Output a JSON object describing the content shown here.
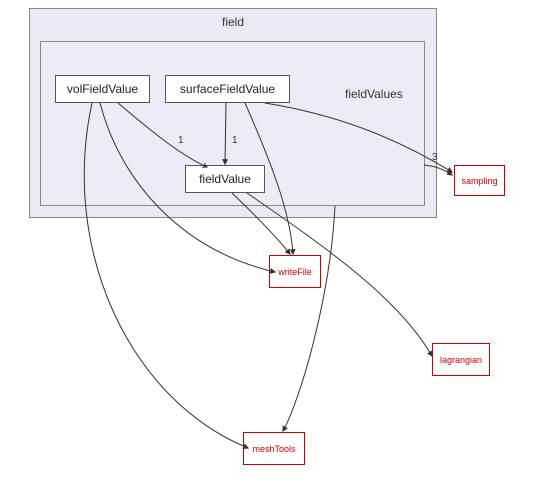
{
  "clusters": {
    "outer": {
      "label": "field"
    },
    "inner_text": "fieldValues"
  },
  "nodes": {
    "volFieldValue": "volFieldValue",
    "surfaceFieldValue": "surfaceFieldValue",
    "fieldValue": "fieldValue",
    "sampling": "sampling",
    "writeFile": "writeFile",
    "lagrangian": "lagrangian",
    "meshTools": "meshTools"
  },
  "edge_labels": {
    "vfv_fv": "1",
    "sfv_fv": "1",
    "fieldValues_sampling": "3"
  },
  "chart_data": {
    "type": "diagram",
    "title": "field / fieldValues dependency graph",
    "clusters": [
      {
        "id": "field",
        "contains": [
          "fieldValues"
        ]
      },
      {
        "id": "fieldValues",
        "contains": [
          "volFieldValue",
          "surfaceFieldValue",
          "fieldValue"
        ]
      }
    ],
    "nodes": [
      {
        "id": "volFieldValue",
        "kind": "dir"
      },
      {
        "id": "surfaceFieldValue",
        "kind": "dir"
      },
      {
        "id": "fieldValue",
        "kind": "dir"
      },
      {
        "id": "sampling",
        "kind": "external"
      },
      {
        "id": "writeFile",
        "kind": "external"
      },
      {
        "id": "lagrangian",
        "kind": "external"
      },
      {
        "id": "meshTools",
        "kind": "external"
      }
    ],
    "edges": [
      {
        "from": "volFieldValue",
        "to": "fieldValue",
        "count": 1
      },
      {
        "from": "surfaceFieldValue",
        "to": "fieldValue",
        "count": 1
      },
      {
        "from": "volFieldValue",
        "to": "writeFile"
      },
      {
        "from": "volFieldValue",
        "to": "meshTools"
      },
      {
        "from": "surfaceFieldValue",
        "to": "sampling"
      },
      {
        "from": "surfaceFieldValue",
        "to": "writeFile"
      },
      {
        "from": "fieldValue",
        "to": "writeFile"
      },
      {
        "from": "fieldValue",
        "to": "lagrangian"
      },
      {
        "from": "fieldValues",
        "to": "sampling",
        "count": 3
      },
      {
        "from": "fieldValues",
        "to": "meshTools"
      }
    ]
  }
}
